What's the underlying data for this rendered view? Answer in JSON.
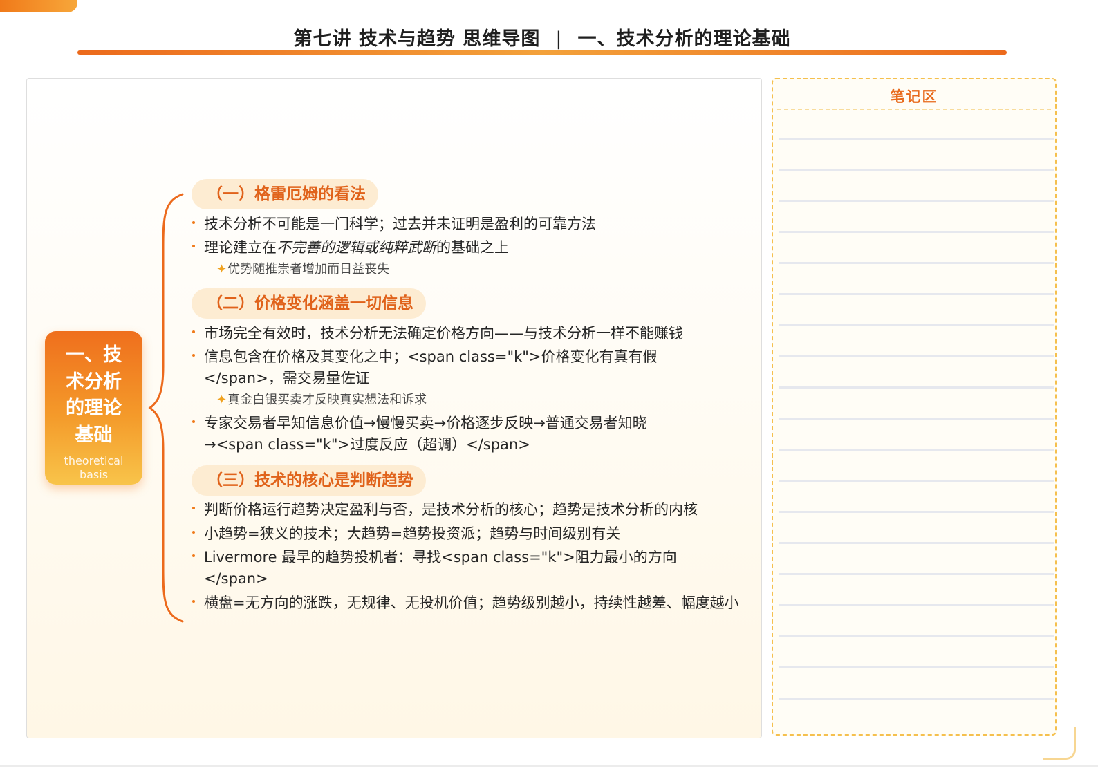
{
  "header": {
    "title_left": "第七讲 技术与趋势 思维导图",
    "separator": "|",
    "title_right": "一、技术分析的理论基础"
  },
  "root": {
    "title": "一、技术分析的理论基础",
    "subtitle": "theoretical basis"
  },
  "sections": [
    {
      "heading": "（一）格雷厄姆的看法",
      "bullets": [
        {
          "text": "技术分析不可能是一门科学；过去并未证明是盈利的可靠方法"
        },
        {
          "prefix": "理论建立在",
          "emphasis": "不完善的逻辑或纯粹武断",
          "suffix": "的基础之上"
        }
      ],
      "note": "优势随推崇者增加而日益丧失"
    },
    {
      "heading": "（二）价格变化涵盖一切信息",
      "bullets": [
        {
          "text": "市场完全有效时，技术分析无法确定价格方向——与技术分析一样不能赚钱"
        },
        {
          "text": "信息包含在价格及其变化之中；<span class=\"k\">价格变化有真有假</span>，需交易量佐证"
        },
        {
          "text": "专家交易者早知信息价值→慢慢买卖→价格逐步反映→普通交易者知晓→<span class=\"k\">过度反应（超调）</span>"
        }
      ],
      "note": "真金白银买卖才反映真实想法和诉求"
    },
    {
      "heading": "（三）技术的核心是判断趋势",
      "bullets": [
        {
          "text": "判断价格运行趋势决定盈利与否，是技术分析的核心；趋势是技术分析的内核"
        },
        {
          "text": "小趋势=狭义的技术；大趋势=趋势投资派；趋势与时间级别有关"
        },
        {
          "text": "Livermore 最早的趋势投机者：寻找<span class=\"k\">阻力最小的方向</span>"
        },
        {
          "text": "横盘=无方向的涨跌，无规律、无投机价值；趋势级别越小，持续性越差、幅度越小"
        }
      ]
    }
  ],
  "notes_panel": {
    "title": "笔记区"
  },
  "colors": {
    "accent": "#ec6a1c",
    "accent_light": "#f5a63a",
    "heading_bg": "#fdecd2",
    "notes_border": "#f5c04e"
  },
  "icons": {
    "note_marker": "star-icon"
  }
}
